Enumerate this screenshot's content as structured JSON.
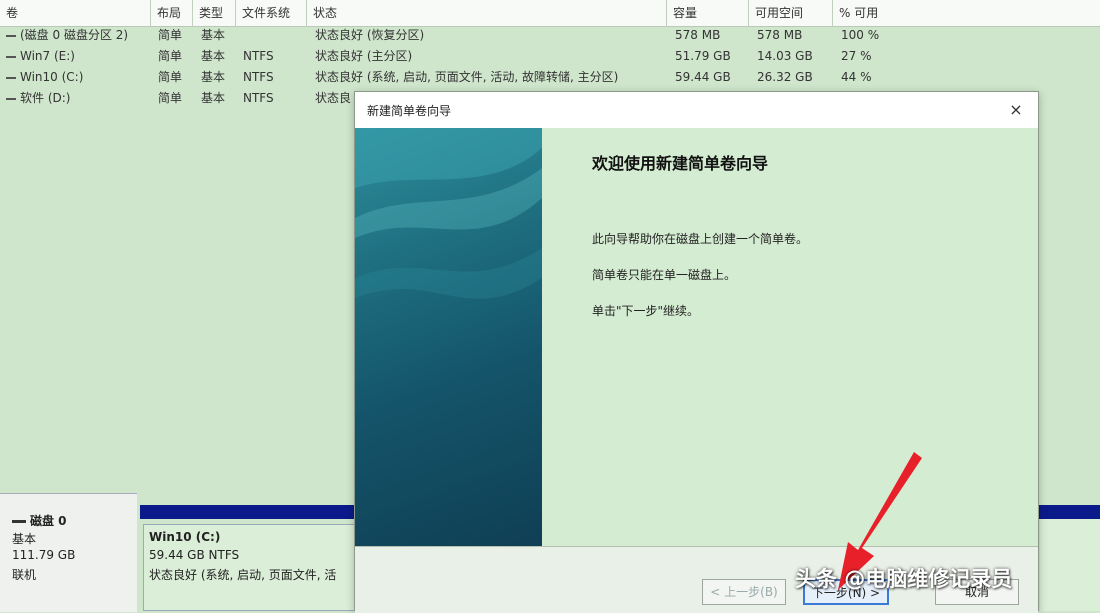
{
  "columns": [
    {
      "key": "volume",
      "label": "卷"
    },
    {
      "key": "layout",
      "label": "布局"
    },
    {
      "key": "type",
      "label": "类型"
    },
    {
      "key": "fs",
      "label": "文件系统"
    },
    {
      "key": "status",
      "label": "状态"
    },
    {
      "key": "capacity",
      "label": "容量"
    },
    {
      "key": "free",
      "label": "可用空间"
    },
    {
      "key": "pct",
      "label": "% 可用"
    }
  ],
  "volumes": [
    {
      "volume": "(磁盘 0 磁盘分区 2)",
      "layout": "简单",
      "type": "基本",
      "fs": "",
      "status": "状态良好 (恢复分区)",
      "capacity": "578 MB",
      "free": "578 MB",
      "pct": "100 %"
    },
    {
      "volume": "Win7 (E:)",
      "layout": "简单",
      "type": "基本",
      "fs": "NTFS",
      "status": "状态良好 (主分区)",
      "capacity": "51.79 GB",
      "free": "14.03 GB",
      "pct": "27 %"
    },
    {
      "volume": "Win10 (C:)",
      "layout": "简单",
      "type": "基本",
      "fs": "NTFS",
      "status": "状态良好 (系统, 启动, 页面文件, 活动, 故障转储, 主分区)",
      "capacity": "59.44 GB",
      "free": "26.32 GB",
      "pct": "44 %"
    },
    {
      "volume": "软件 (D:)",
      "layout": "简单",
      "type": "基本",
      "fs": "NTFS",
      "status": "状态良",
      "capacity": "",
      "free": "",
      "pct": ""
    }
  ],
  "disk": {
    "name": "磁盘 0",
    "kind": "基本",
    "size": "111.79 GB",
    "state": "联机"
  },
  "partition": {
    "name": "Win10  (C:)",
    "size_fs": "59.44 GB NTFS",
    "status": "状态良好 (系统, 启动, 页面文件, 活"
  },
  "wizard": {
    "title": "新建简单卷向导",
    "close": "×",
    "heading": "欢迎使用新建简单卷向导",
    "p1": "此向导帮助你在磁盘上创建一个简单卷。",
    "p2": "简单卷只能在单一磁盘上。",
    "p3": "单击\"下一步\"继续。",
    "back_label": "< 上一步(B)",
    "next_label": "下一步(N) >",
    "cancel_label": "取消"
  },
  "watermark": "头条 @电脑维修记录员",
  "colors": {
    "background": "#cfe6cc",
    "disk_bar": "#0b1a8a",
    "arrow": "#e8202a"
  }
}
